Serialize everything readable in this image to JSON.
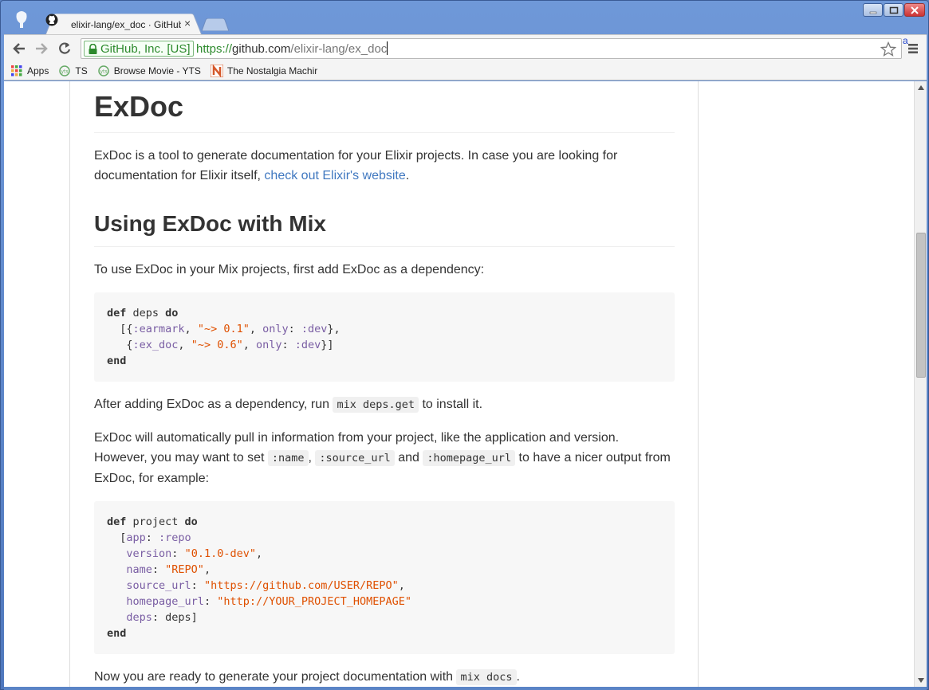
{
  "window": {
    "tab_title": "elixir-lang/ex_doc · GitHub",
    "tab_close": "×",
    "controls": {
      "minimize": "minimize",
      "maximize": "maximize",
      "close": "close"
    }
  },
  "toolbar": {
    "ev_label": "GitHub, Inc. [US]",
    "url_scheme": "https://",
    "url_host": "github.com",
    "url_path": "/elixir-lang/ex_doc",
    "ext_badge": "a"
  },
  "bookmarks": [
    {
      "label": "Apps",
      "icon": "apps-grid-icon"
    },
    {
      "label": "TS",
      "icon": "yts-icon"
    },
    {
      "label": "Browse Movie - YTS",
      "icon": "yts-icon"
    },
    {
      "label": "The Nostalgia Machir",
      "icon": "netflix-n-icon"
    }
  ],
  "article": {
    "h1": "ExDoc",
    "intro_text": "ExDoc is a tool to generate documentation for your Elixir projects. In case you are looking for documentation for Elixir itself, ",
    "intro_link": "check out Elixir's website",
    "intro_end": ".",
    "h2": "Using ExDoc with Mix",
    "p_add_dep": "To use ExDoc in your Mix projects, first add ExDoc as a dependency:",
    "p_after_1": "After adding ExDoc as a dependency, run ",
    "code_deps_get": "mix deps.get",
    "p_after_2": " to install it.",
    "p_pull_1": "ExDoc will automatically pull in information from your project, like the application and version. However, you may want to set ",
    "code_name": ":name",
    "p_pull_comma": ", ",
    "code_source_url": ":source_url",
    "p_pull_and": " and ",
    "code_homepage_url": ":homepage_url",
    "p_pull_2": " to have a nicer output from ExDoc, for example:",
    "p_ready_1": "Now you are ready to generate your project documentation with ",
    "code_mix_docs": "mix docs",
    "p_ready_2": "."
  },
  "code_block_1": {
    "def": "def",
    "deps": " deps ",
    "do": "do",
    "l2_open": "  [{",
    "earmark": ":earmark",
    "c1": ", ",
    "earmark_ver": "\"~> 0.1\"",
    "c2": ", ",
    "only1": "only",
    "colon1": ": ",
    "dev1": ":dev",
    "l2_close": "},",
    "l3_open": "   {",
    "ex_doc": ":ex_doc",
    "c3": ", ",
    "ex_doc_ver": "\"~> 0.6\"",
    "c4": ", ",
    "only2": "only",
    "colon2": ": ",
    "dev2": ":dev",
    "l3_close": "}]",
    "end": "end"
  },
  "code_block_2": {
    "def": "def",
    "project": " project ",
    "do": "do",
    "app_open": "  [",
    "app": "app",
    "app_colon": ": ",
    "repo_atom": ":repo",
    "version_key": "version",
    "version_colon": ": ",
    "version_val": "\"0.1.0-dev\"",
    "version_comma": ",",
    "name_key": "name",
    "name_colon": ": ",
    "name_val": "\"REPO\"",
    "name_comma": ",",
    "source_key": "source_url",
    "source_colon": ": ",
    "source_val": "\"https://github.com/USER/REPO\"",
    "source_comma": ",",
    "homepage_key": "homepage_url",
    "homepage_colon": ": ",
    "homepage_val": "\"http://YOUR_PROJECT_HOMEPAGE\"",
    "deps_key": "deps",
    "deps_colon": ": ",
    "deps_val": "deps]",
    "end": "end"
  },
  "colors": {
    "link": "#4078c0",
    "atom": "#795da3",
    "string": "#df5000",
    "ev_green": "#2d8a2d"
  }
}
